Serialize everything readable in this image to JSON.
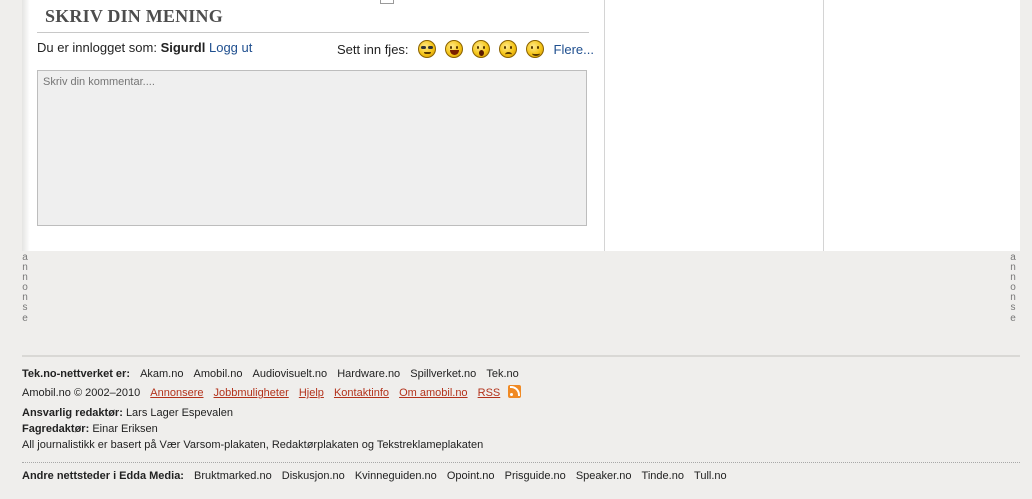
{
  "comment_section": {
    "heading": "SKRIV DIN MENING",
    "logged_in_label": "Du er innlogget som:",
    "username": "Sigurdl",
    "logout_link": "Logg ut",
    "insert_smiley_label": "Sett inn fjes:",
    "smileys": [
      "cool-smiley-icon",
      "laugh-smiley-icon",
      "shocked-smiley-icon",
      "sad-smiley-icon",
      "smirk-smiley-icon"
    ],
    "more_smileys_link": "Flere...",
    "comment_placeholder": "Skriv din kommentar...."
  },
  "ad_label": [
    "a",
    "n",
    "n",
    "o",
    "n",
    "s",
    "e"
  ],
  "footer": {
    "network_label": "Tek.no-nettverket er:",
    "network_sites": [
      "Akam.no",
      "Amobil.no",
      "Audiovisuelt.no",
      "Hardware.no",
      "Spillverket.no",
      "Tek.no"
    ],
    "copyright": "Amobil.no © 2002–2010",
    "info_links": [
      "Annonsere",
      "Jobbmuligheter",
      "Hjelp",
      "Kontaktinfo",
      "Om amobil.no",
      "RSS"
    ],
    "editor_label": "Ansvarlig redaktør:",
    "editor_name": "Lars Lager Espevalen",
    "subject_editor_label": "Fagredaktør:",
    "subject_editor_name": "Einar Eriksen",
    "ethics_statement": "All journalistikk er basert på Vær Varsom-plakaten, Redaktørplakaten og Tekstreklameplakaten",
    "edda_label": "Andre nettsteder i Edda Media:",
    "edda_sites": [
      "Bruktmarked.no",
      "Diskusjon.no",
      "Kvinneguiden.no",
      "Opoint.no",
      "Prisguide.no",
      "Speaker.no",
      "Tinde.no",
      "Tull.no"
    ]
  },
  "colors": {
    "link_blue": "#1f4f8f",
    "footer_link_red": "#b3321b",
    "page_background": "#efeeec",
    "rss_orange": "#f08a24"
  }
}
